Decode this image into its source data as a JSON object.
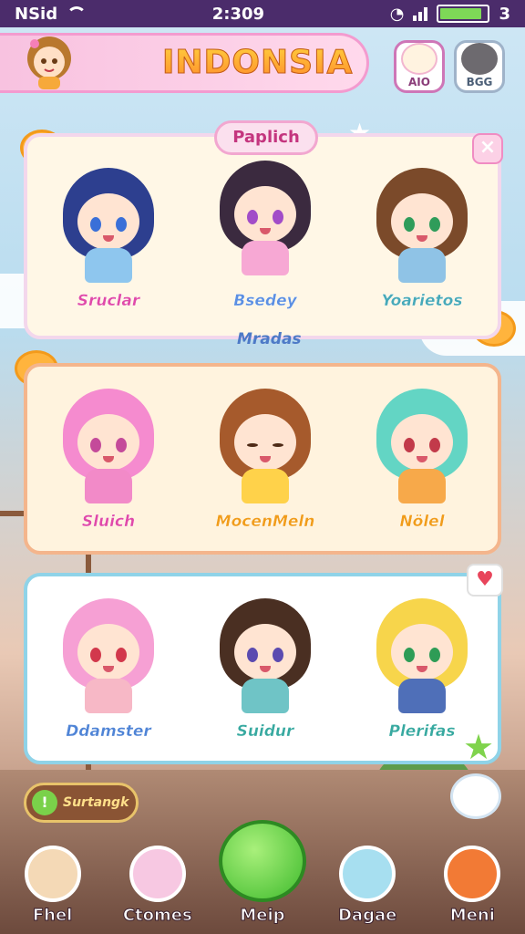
{
  "status": {
    "carrier": "NSid",
    "time": "2:309",
    "battery_level": 0.9,
    "battery_suffix": "3"
  },
  "header": {
    "title": "INDONSIA",
    "profiles": [
      {
        "label": "AIO"
      },
      {
        "label": "BGG"
      }
    ]
  },
  "panel1": {
    "tag": "Paplich",
    "close": "×",
    "characters": [
      {
        "name": "Sruclar",
        "name_color": "#e04aa8"
      },
      {
        "name": "Bsedey",
        "name_color": "#5b8fe2"
      },
      {
        "name": "Yoarietos",
        "name_color": "#47a9b8"
      }
    ],
    "subtitle": "Mradas"
  },
  "panel2": {
    "characters": [
      {
        "name": "Sluich",
        "name_color": "#e04aa8"
      },
      {
        "name": "MocenMeln",
        "name_color": "#f19c1a"
      },
      {
        "name": "Nölel",
        "name_color": "#f19c1a"
      }
    ]
  },
  "panel3": {
    "characters": [
      {
        "name": "Ddamster",
        "name_color": "#4f84d6"
      },
      {
        "name": "Suidur",
        "name_color": "#37a9a0"
      },
      {
        "name": "Plerifas",
        "name_color": "#37a9a0"
      }
    ]
  },
  "survey": {
    "label": "Surtangk",
    "icon": "!"
  },
  "nav": [
    {
      "label": "Fhel",
      "icon": "smiley-face-icon"
    },
    {
      "label": "Ctomes",
      "icon": "character-portrait-icon"
    },
    {
      "label": "Meip",
      "icon": "green-chat-bubble-icon"
    },
    {
      "label": "Dagae",
      "icon": "character-portrait-icon"
    },
    {
      "label": "Meni",
      "icon": "food-bowl-icon"
    }
  ]
}
